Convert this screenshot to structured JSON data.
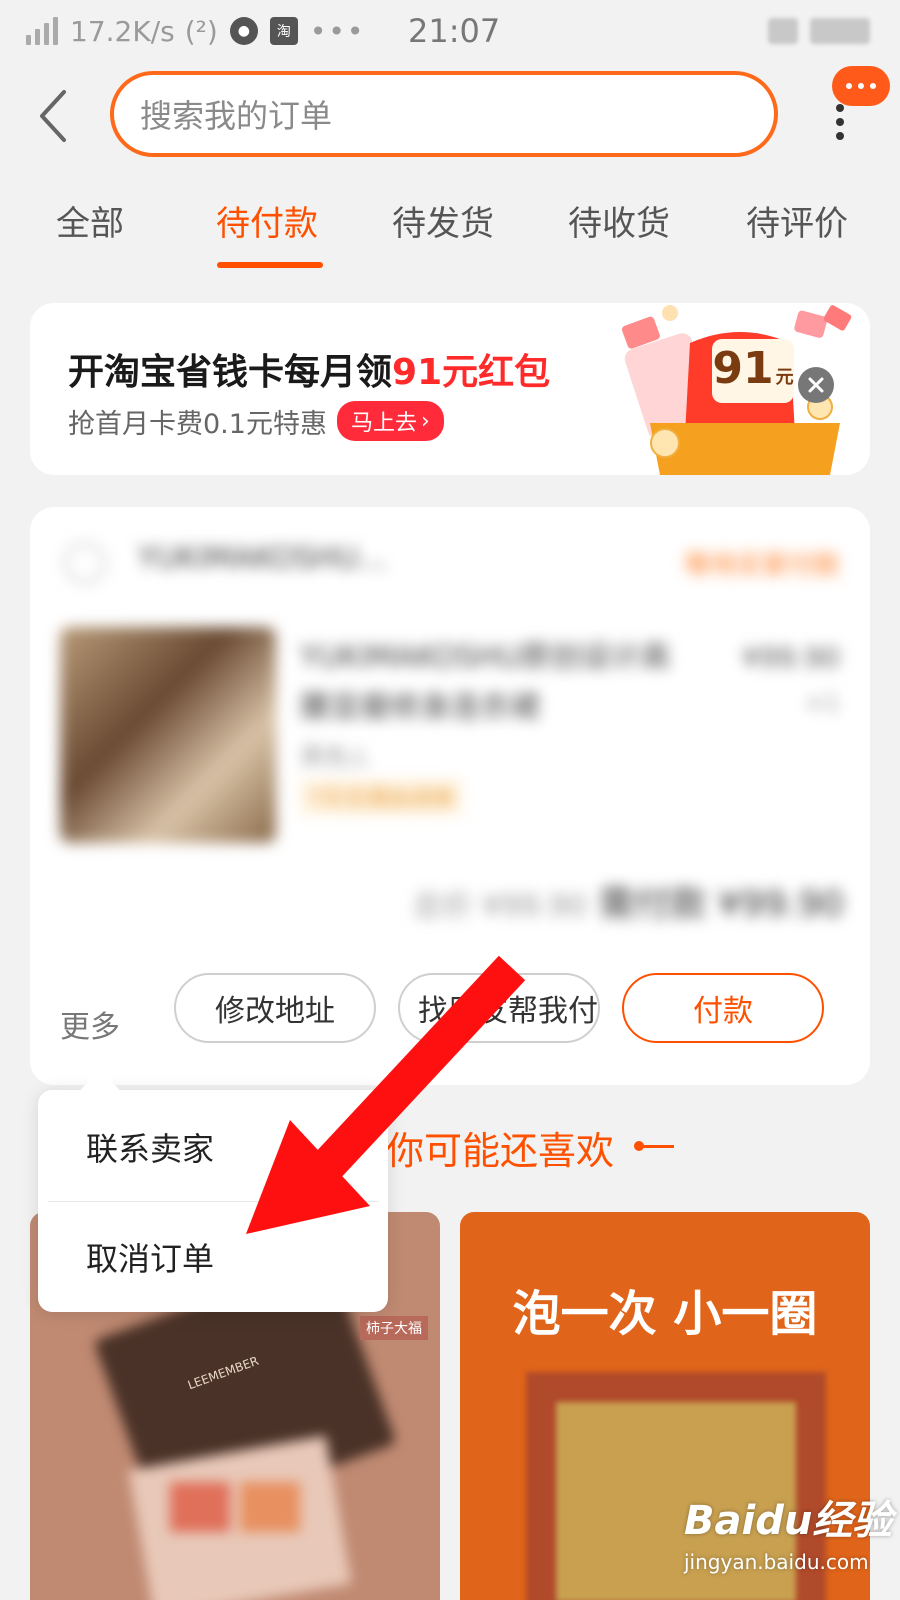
{
  "status_bar": {
    "speed": "17.2K/s",
    "hd_icon": "(²)",
    "app_badge": "淘",
    "dots": "•••",
    "time": "21:07"
  },
  "header": {
    "search_placeholder": "搜索我的订单"
  },
  "tabs": [
    {
      "label": "全部"
    },
    {
      "label": "待付款",
      "active": true
    },
    {
      "label": "待发货"
    },
    {
      "label": "待收货"
    },
    {
      "label": "待评价"
    }
  ],
  "banner": {
    "title_prefix": "开淘宝省钱卡每月领",
    "title_highlight": "91元红包",
    "subtitle": "抢首月卡费0.1元特惠",
    "cta": "马上去",
    "packet_amount": "91",
    "packet_unit": "元"
  },
  "order": {
    "shop_name": "YUKIMAKOSHU...",
    "status": "等待买家付款",
    "product_title": "YUKIMAKOSHU原创设计高腰显瘦修身连衣裙",
    "product_sku": "黑色;L",
    "product_tag": "7天无理由退换",
    "product_price": "¥99.90",
    "product_qty": "×1",
    "total_label": "总价 ¥99.90",
    "need_pay_label": "需付款",
    "need_pay_amount": "¥99.90",
    "more_label": "更多",
    "buttons": {
      "modify_address": "修改地址",
      "friend_pay": "找朋友帮我付",
      "pay": "付款"
    }
  },
  "more_menu": {
    "items": [
      "联系卖家",
      "取消订单"
    ]
  },
  "recommend": {
    "title": "你可能还喜欢",
    "left_card_label": "柿子大福",
    "left_card_brand": "LEEMEMBER",
    "right_card_text": "泡一次 小一圈"
  },
  "watermark": {
    "logo": "Baidu经验",
    "url": "jingyan.baidu.com"
  },
  "colors": {
    "accent": "#ff5000",
    "banner_highlight": "#ff2a2a",
    "annotation_arrow": "#ff1010"
  }
}
